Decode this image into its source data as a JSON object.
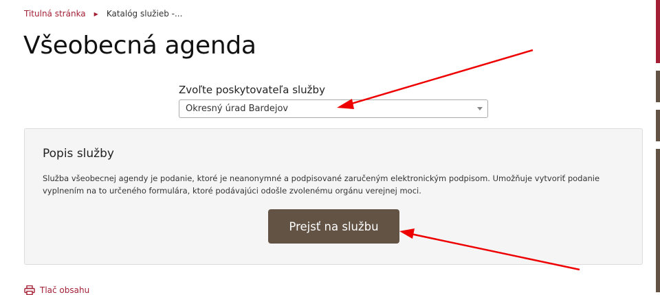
{
  "breadcrumb": {
    "home": "Titulná stránka",
    "current": "Katalóg služieb -..."
  },
  "page": {
    "title": "Všeobecná agenda"
  },
  "provider": {
    "label": "Zvoľte poskytovateľa služby",
    "selected": "Okresný úrad Bardejov"
  },
  "description": {
    "title": "Popis služby",
    "text": "Služba všeobecnej agendy je podanie, ktoré je neanonymné a podpisované zaručeným elektronickým podpisom. Umožňuje vytvoriť podanie vyplnením na to určeného formulára, ktoré podávajúci odošle zvolenému orgánu verejnej moci.",
    "button_label": "Prejsť na službu"
  },
  "footer": {
    "print_label": "Tlač obsahu",
    "print_icon": "printer-icon"
  },
  "colors": {
    "link": "#a31f34",
    "button": "#625345",
    "annotation_arrow": "#ee0000",
    "side_tab_red": "#a31f34",
    "side_tab_brown": "#625345"
  }
}
